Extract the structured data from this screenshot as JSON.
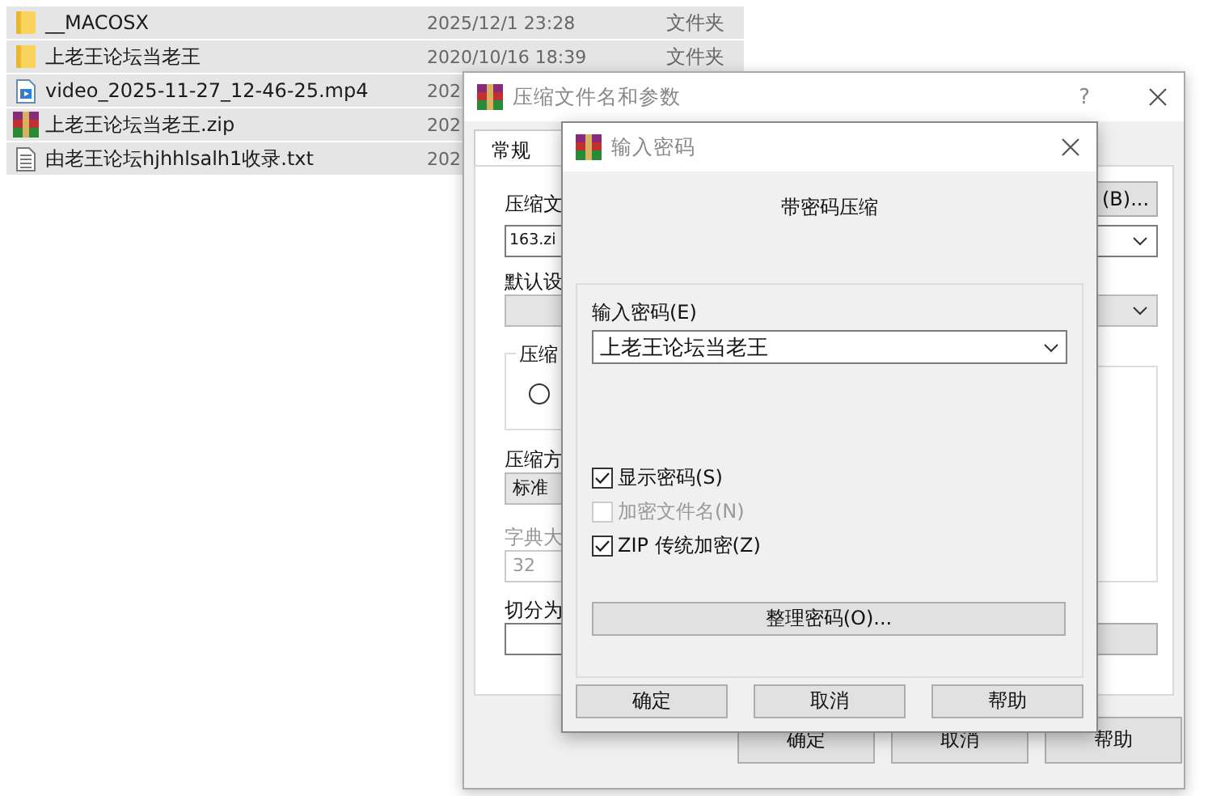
{
  "files": [
    {
      "name": "__MACOSX",
      "date": "2025/12/1 23:28",
      "type": "文件夹",
      "kind": "folder"
    },
    {
      "name": "上老王论坛当老王",
      "date": "2020/10/16 18:39",
      "type": "文件夹",
      "kind": "folder"
    },
    {
      "name": "video_2025-11-27_12-46-25.mp4",
      "date": "202",
      "kind": "video"
    },
    {
      "name": "上老王论坛当老王.zip",
      "date": "202",
      "kind": "archive"
    },
    {
      "name": "由老王论坛hjhhlsalh1收录.txt",
      "date": "202",
      "kind": "text"
    }
  ],
  "main_dialog": {
    "title": "压缩文件名和参数",
    "help_mark": "?",
    "tabs": [
      {
        "label": "常规",
        "selected": true
      }
    ],
    "general": {
      "archive_name_label": "压缩文",
      "archive_name": "163.zi",
      "browse_button": "(B)...",
      "profile_label": "默认设",
      "format_group_label": "压缩",
      "format_radio_selected": false,
      "method_label": "压缩方",
      "method": "标准",
      "dictionary_label": "字典大",
      "dictionary": "32",
      "dictionary_disabled": true,
      "split_label": "切分为"
    },
    "buttons": [
      "确定",
      "取消",
      "帮助"
    ]
  },
  "password_dialog": {
    "title": "输入密码",
    "heading": "带密码压缩",
    "password_label": "输入密码(E)",
    "password": "上老王论坛当老王",
    "options": [
      {
        "label": "显示密码(S)",
        "checked": true,
        "disabled": false
      },
      {
        "label": "加密文件名(N)",
        "checked": false,
        "disabled": true
      },
      {
        "label": "ZIP 传统加密(Z)",
        "checked": true,
        "disabled": false
      }
    ],
    "organize_button": "整理密码(O)...",
    "buttons": [
      "确定",
      "取消",
      "帮助"
    ]
  }
}
